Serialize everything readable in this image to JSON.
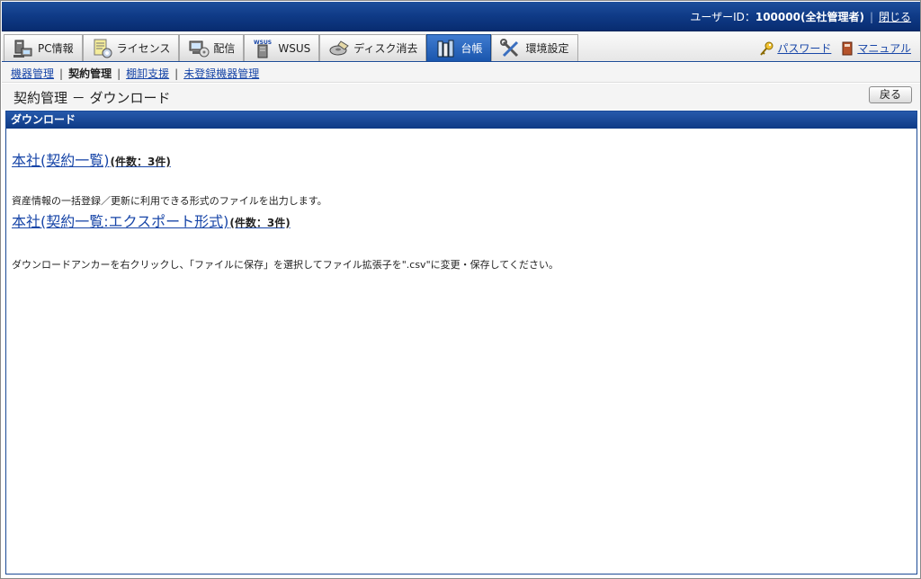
{
  "header": {
    "user_label": "ユーザーID：",
    "user_value": "100000(全社管理者)",
    "separator": "|",
    "close_label": "閉じる"
  },
  "tabs": [
    {
      "label": "PC情報",
      "icon": "pc-icon"
    },
    {
      "label": "ライセンス",
      "icon": "license-icon"
    },
    {
      "label": "配信",
      "icon": "distribution-icon"
    },
    {
      "label": "WSUS",
      "icon": "wsus-server-icon"
    },
    {
      "label": "ディスク消去",
      "icon": "disk-erase-icon"
    },
    {
      "label": "台帳",
      "icon": "ledger-books-icon",
      "active": true
    },
    {
      "label": "環境設定",
      "icon": "tools-icon"
    }
  ],
  "tabs_right": {
    "password_label": "パスワード",
    "manual_label": "マニュアル"
  },
  "subnav": {
    "items": [
      {
        "label": "機器管理",
        "link": true
      },
      {
        "label": "契約管理",
        "link": false
      },
      {
        "label": "棚卸支援",
        "link": true
      },
      {
        "label": "未登録機器管理",
        "link": true
      }
    ],
    "pipe": "|"
  },
  "page": {
    "title": "契約管理 － ダウンロード",
    "back_label": "戻る"
  },
  "panel": {
    "header": "ダウンロード",
    "link1_label": "本社(契約一覧)",
    "link1_count": "(件数：3件)",
    "desc1": "資産情報の一括登録／更新に利用できる形式のファイルを出力します。",
    "link2_label": "本社(契約一覧:エクスポート形式)",
    "link2_count": "(件数：3件)",
    "desc2": "ダウンロードアンカーを右クリックし、「ファイルに保存」を選択してファイル拡張子を\".csv\"に変更・保存してください。"
  },
  "colors": {
    "header_blue": "#0f3a86",
    "link_blue": "#1846a8",
    "active_tab": "#1a56ad"
  }
}
